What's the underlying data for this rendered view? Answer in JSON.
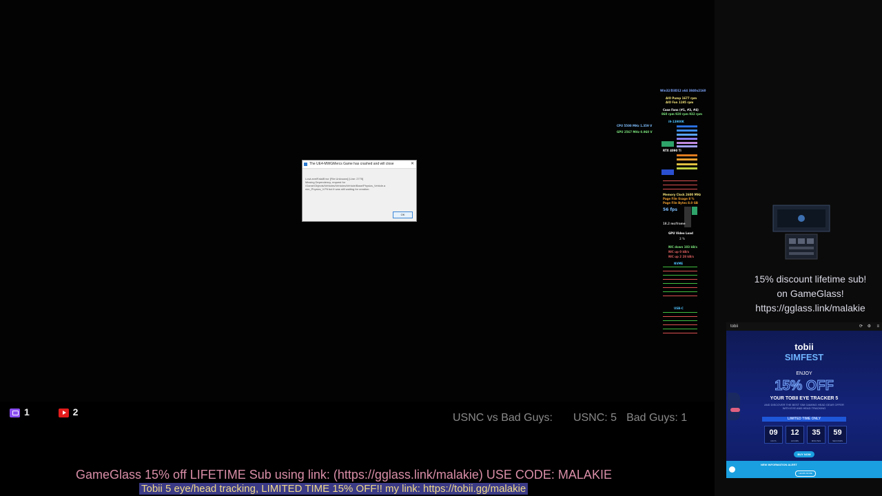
{
  "dialog": {
    "title": "The UE4-MWGMercs Game has crashed and will close",
    "body": "LowLevelFatalError [File:Unknown] [Line: 2775]\nMissing Dependency, request for\n/Game/Objects/Vehicles/Vehicles/Vehicle/Base/Physics_Vehicle.a\nnim_Physics_V.Pit but it was still waiting for creation.",
    "ok_label": "OK"
  },
  "overlay": {
    "header": "Win32/D3D12 x64 3840x2160",
    "aio_pump": "AIO Pump  1677 rpm",
    "aio_fan": "AIO Fan    1195 rpm",
    "case_fans": "Case Fans (#1, #3, #4)",
    "case_fans_rpm": "860 rpm   920 rpm   932 rpm",
    "cpu_model": "i9-13900K",
    "gpu_model": "RTX 4090 Ti",
    "cpu_line": "CPU  5500 MHz  1.359 V",
    "gpu_line": "GPU  2567 MHz  0.960 V",
    "fps": "56 fps",
    "frametime": "18.2 ms/frame",
    "gpu_video_load": "GPU Video Load",
    "gpu_video_load_val": "2 %",
    "net_download": "NIC down  103 kB/s",
    "net_up1": "NIC up    0 kB/s",
    "net_up2": "NIC up 2  28 kB/s",
    "disk1_label": "NVME",
    "disk2_label": "USB-C",
    "memory_clock": "Memory Clock  2600 MHz",
    "page_file_usage": "Page File Usage  8 %",
    "page_file_bytes": "Page File Bytes  8.0 GB"
  },
  "scoreboard": {
    "matchup": "USNC vs Bad Guys:",
    "usnc": "USNC: 5",
    "bad_guys": "Bad Guys: 1"
  },
  "platforms": {
    "twitch_count": "1",
    "youtube_count": "2"
  },
  "tickers": {
    "line1": "GameGlass 15% off LIFETIME Sub using link: (https://gglass.link/malakie)  USE CODE:  MALAKIE",
    "line2": "Tobii 5 eye/head tracking, LIMITED TIME 15% OFF!!  my link:  https://tobii.gg/malakie"
  },
  "gameglass": {
    "line1": "15% discount lifetime sub!",
    "line2": "on GameGlass!",
    "line3": "https://gglass.link/malakie"
  },
  "tobii": {
    "bar_label": "tobii",
    "brand": "tobii",
    "event": "SIMFEST",
    "enjoy": "ENJOY",
    "discount": "15% OFF",
    "product": "YOUR TOBII EYE TRACKER 5",
    "subtext": "AND DISCOVER THE BEST SIM GAMING HEAD GEAR OFFER WITH EYE AND HEAD TRACKING",
    "limited": "LIMITED TIME ONLY",
    "countdown": [
      {
        "value": "09",
        "unit": "DAYS"
      },
      {
        "value": "12",
        "unit": "HOURS"
      },
      {
        "value": "35",
        "unit": "MINUTES"
      },
      {
        "value": "59",
        "unit": "SECONDS"
      }
    ],
    "buy_label": "BUY NOW",
    "footer_text": "NEW INFORMATION ALERT",
    "footer_button": "LEARN MORE"
  },
  "colors": {
    "twitch": "#8a4ef0",
    "youtube": "#e41c1c",
    "ticker1": "#d98ea7",
    "ticker2": "#f0d98a",
    "tobii_blue": "#1aa0e0"
  }
}
